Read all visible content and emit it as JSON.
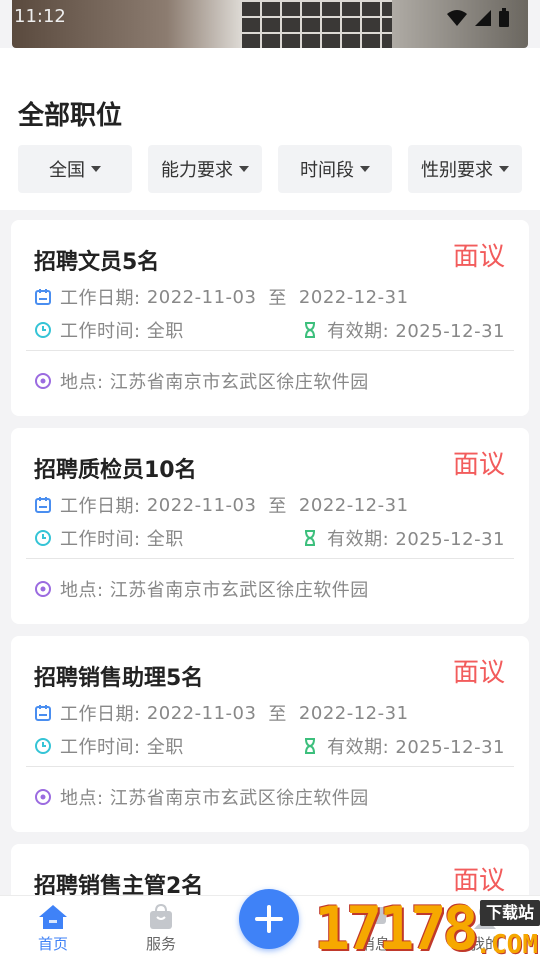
{
  "status_bar": {
    "time": "11:12"
  },
  "page": {
    "title": "全部职位"
  },
  "filters": [
    {
      "label": "全国"
    },
    {
      "label": "能力要求"
    },
    {
      "label": "时间段"
    },
    {
      "label": "性别要求"
    }
  ],
  "jobs": [
    {
      "title": "招聘文员5名",
      "salary": "面议",
      "date_label": "工作日期:",
      "date_start": "2022-11-03",
      "date_to": "至",
      "date_end": "2022-12-31",
      "work_time": "工作时间: 全职",
      "valid": "有效期: 2025-12-31",
      "location": "地点: 江苏省南京市玄武区徐庄软件园"
    },
    {
      "title": "招聘质检员10名",
      "salary": "面议",
      "date_label": "工作日期:",
      "date_start": "2022-11-03",
      "date_to": "至",
      "date_end": "2022-12-31",
      "work_time": "工作时间: 全职",
      "valid": "有效期: 2025-12-31",
      "location": "地点: 江苏省南京市玄武区徐庄软件园"
    },
    {
      "title": "招聘销售助理5名",
      "salary": "面议",
      "date_label": "工作日期:",
      "date_start": "2022-11-03",
      "date_to": "至",
      "date_end": "2022-12-31",
      "work_time": "工作时间: 全职",
      "valid": "有效期: 2025-12-31",
      "location": "地点: 江苏省南京市玄武区徐庄软件园"
    },
    {
      "title": "招聘销售主管2名",
      "salary": "面议"
    }
  ],
  "tabbar": {
    "home": "首页",
    "service": "服务",
    "message": "消息",
    "mine": "我的"
  },
  "watermark": {
    "number": "17178",
    "badge": "下载站",
    "suffix": ".COM"
  },
  "colors": {
    "accent": "#3f82f7",
    "salary": "#f25c5c",
    "date_icon": "#4a8ef0",
    "time_icon": "#35c4d6",
    "valid_icon": "#3cbf7c",
    "location_icon": "#9b6be0"
  }
}
